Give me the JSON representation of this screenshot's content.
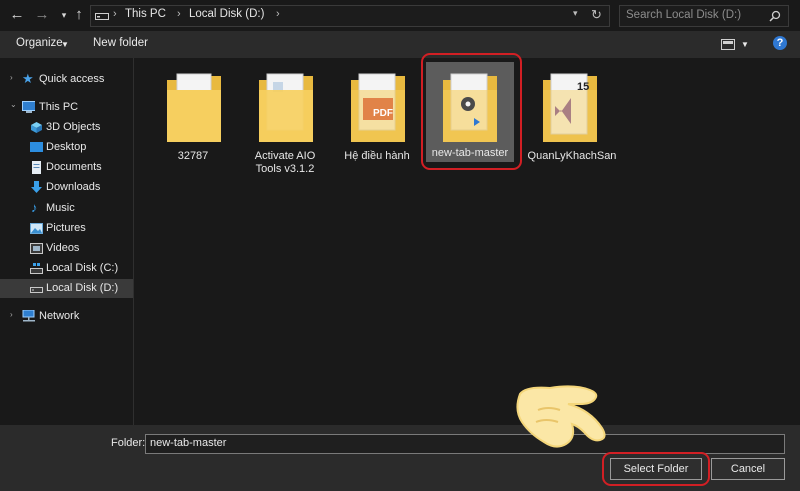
{
  "address": {
    "crumbs": [
      "This PC",
      "Local Disk (D:)"
    ],
    "search_placeholder": "Search Local Disk (D:)"
  },
  "toolbar": {
    "organize_label": "Organize",
    "new_folder_label": "New folder"
  },
  "nav": {
    "quick_access": "Quick access",
    "this_pc": "This PC",
    "items": [
      "3D Objects",
      "Desktop",
      "Documents",
      "Downloads",
      "Music",
      "Pictures",
      "Videos",
      "Local Disk (C:)",
      "Local Disk (D:)"
    ],
    "network": "Network"
  },
  "folders": [
    {
      "label_1": "32787",
      "label_2": ""
    },
    {
      "label_1": "Activate AIO",
      "label_2": "Tools v3.1.2"
    },
    {
      "label_1": "Hệ điều hành",
      "label_2": ""
    },
    {
      "label_1": "new-tab-master",
      "label_2": ""
    },
    {
      "label_1": "QuanLyKhachSan",
      "label_2": ""
    }
  ],
  "badges": {
    "pdf": "PDF",
    "vs_version": "15"
  },
  "footer": {
    "folder_label": "Folder:",
    "folder_value": "new-tab-master",
    "select_label": "Select Folder",
    "cancel_label": "Cancel"
  },
  "colors": {
    "highlight": "#d21f24",
    "folder": "#f3c24f",
    "selected_tile": "#5c5c5c",
    "help": "#2f78d2"
  }
}
